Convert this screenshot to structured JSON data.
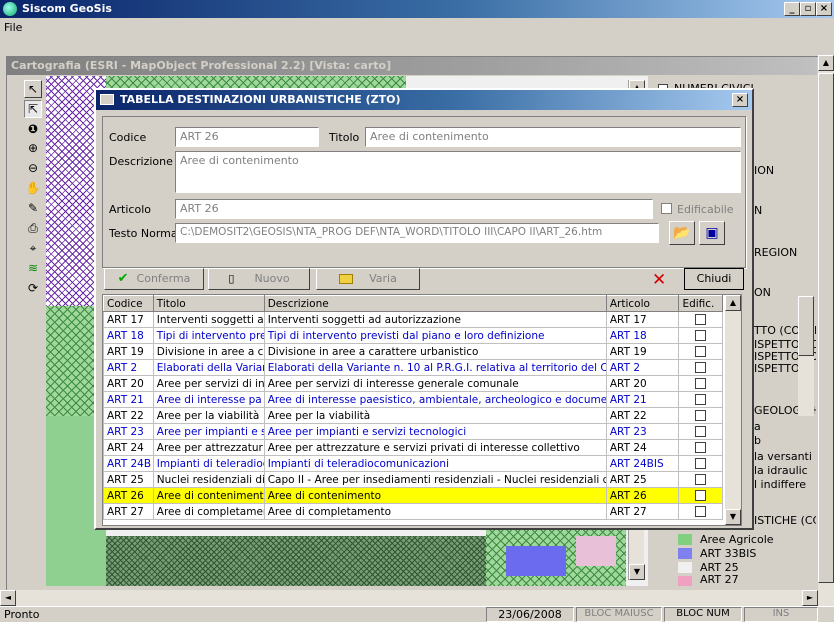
{
  "app": {
    "title": "Siscom GeoSis",
    "menu": [
      "File"
    ]
  },
  "map_window": {
    "title": "Cartografia (ESRI - MapObject Professional 2.2) [Vista: carto]"
  },
  "legend": {
    "items": [
      {
        "label": "NUMERI CIVICI"
      },
      {
        "label": "ION"
      },
      {
        "label": "N"
      },
      {
        "label": "REGION"
      },
      {
        "label": "ON"
      },
      {
        "label": "TTO (COD_N"
      },
      {
        "label": "ISPETTO CO"
      },
      {
        "label": "ISPETTO PO"
      },
      {
        "label": "ISPETTO CI"
      },
      {
        "label": "GEOLOGICH"
      },
      {
        "label": "a"
      },
      {
        "label": "b"
      },
      {
        "label": "la versanti"
      },
      {
        "label": "la idraulic"
      },
      {
        "label": "l indiffere"
      },
      {
        "label": "ISTICHE (CC"
      }
    ],
    "swatches": [
      {
        "label": "Aree Agricole",
        "color": "#80d080"
      },
      {
        "label": "ART 33BIS",
        "color": "#8080f0"
      },
      {
        "label": "ART 25",
        "color": "#f0f0f0"
      },
      {
        "label": "ART 27",
        "color": "#f0a0c0"
      }
    ]
  },
  "dialog": {
    "title": "TABELLA DESTINAZIONI URBANISTICHE (ZTO)",
    "codice_label": "Codice",
    "codice_value": "ART 26",
    "titolo_label": "Titolo",
    "titolo_value": "Aree di contenimento",
    "descrizione_label": "Descrizione",
    "descrizione_value": "Aree di contenimento",
    "articolo_label": "Articolo",
    "articolo_value": "ART 26",
    "edificabile_label": "Edificabile",
    "testo_norma_label": "Testo Norma",
    "testo_norma_value": "C:\\DEMOSIT2\\GEOSIS\\NTA_PROG DEF\\NTA_WORD\\TITOLO III\\CAPO II\\ART_26.htm",
    "buttons": {
      "conferma": "Conferma",
      "nuovo": "Nuovo",
      "varia": "Varia",
      "chiudi": "Chiudi"
    },
    "columns": [
      "Codice",
      "Titolo",
      "Descrizione",
      "Articolo",
      "Edific."
    ],
    "rows": [
      {
        "codice": "ART 17",
        "titolo": "Interventi soggetti ad",
        "descrizione": "Interventi soggetti ad autorizzazione",
        "articolo": "ART 17",
        "style": "normal"
      },
      {
        "codice": "ART 18",
        "titolo": "Tipi di intervento previ",
        "descrizione": "Tipi di intervento previsti dal piano e loro definizione",
        "articolo": "ART 18",
        "style": "blue"
      },
      {
        "codice": "ART 19",
        "titolo": "Divisione in aree a ca",
        "descrizione": "Divisione in aree a carattere urbanistico",
        "articolo": "ART 19",
        "style": "normal"
      },
      {
        "codice": "ART 2",
        "titolo": "Elaborati della Variar",
        "descrizione": "Elaborati della Variante n. 10  al P.R.G.I. relativa al territorio del Co",
        "articolo": "ART 2",
        "style": "blue"
      },
      {
        "codice": "ART 20",
        "titolo": "Aree per servizi di in",
        "descrizione": "Aree per servizi di interesse generale comunale",
        "articolo": "ART 20",
        "style": "normal"
      },
      {
        "codice": "ART 21",
        "titolo": "Aree di interesse pa",
        "descrizione": "Aree di interesse paesistico, ambientale, archeologico e documen",
        "articolo": "ART 21",
        "style": "blue"
      },
      {
        "codice": "ART 22",
        "titolo": "Aree per la viabilità",
        "descrizione": "Aree per la viabilità",
        "articolo": "ART 22",
        "style": "normal"
      },
      {
        "codice": "ART 23",
        "titolo": "Aree per impianti e s",
        "descrizione": "Aree per impianti e servizi tecnologici",
        "articolo": "ART 23",
        "style": "blue"
      },
      {
        "codice": "ART 24",
        "titolo": "Aree per attrezzatur",
        "descrizione": "Aree per attrezzature e servizi privati di interesse collettivo",
        "articolo": "ART 24",
        "style": "normal"
      },
      {
        "codice": "ART 24B",
        "titolo": "Impianti di teleradioc",
        "descrizione": "Impianti di teleradiocomunicazioni",
        "articolo": "ART 24BIS",
        "style": "blue"
      },
      {
        "codice": "ART 25",
        "titolo": "Nuclei residenziali di",
        "descrizione": "Capo II - Aree per insediamenti residenziali - Nuclei residenziali di",
        "articolo": "ART 25",
        "style": "normal"
      },
      {
        "codice": "ART 26",
        "titolo": "Aree di contenimento",
        "descrizione": "Aree di contenimento",
        "articolo": "ART 26",
        "style": "selected"
      },
      {
        "codice": "ART 27",
        "titolo": "Aree di completamer",
        "descrizione": "Aree di completamento",
        "articolo": "ART 27",
        "style": "normal"
      }
    ]
  },
  "status": {
    "text": "Pronto",
    "date": "23/06/2008",
    "caps": "BLOC MAIUSC",
    "num": "BLOC NUM",
    "ins": "INS"
  }
}
